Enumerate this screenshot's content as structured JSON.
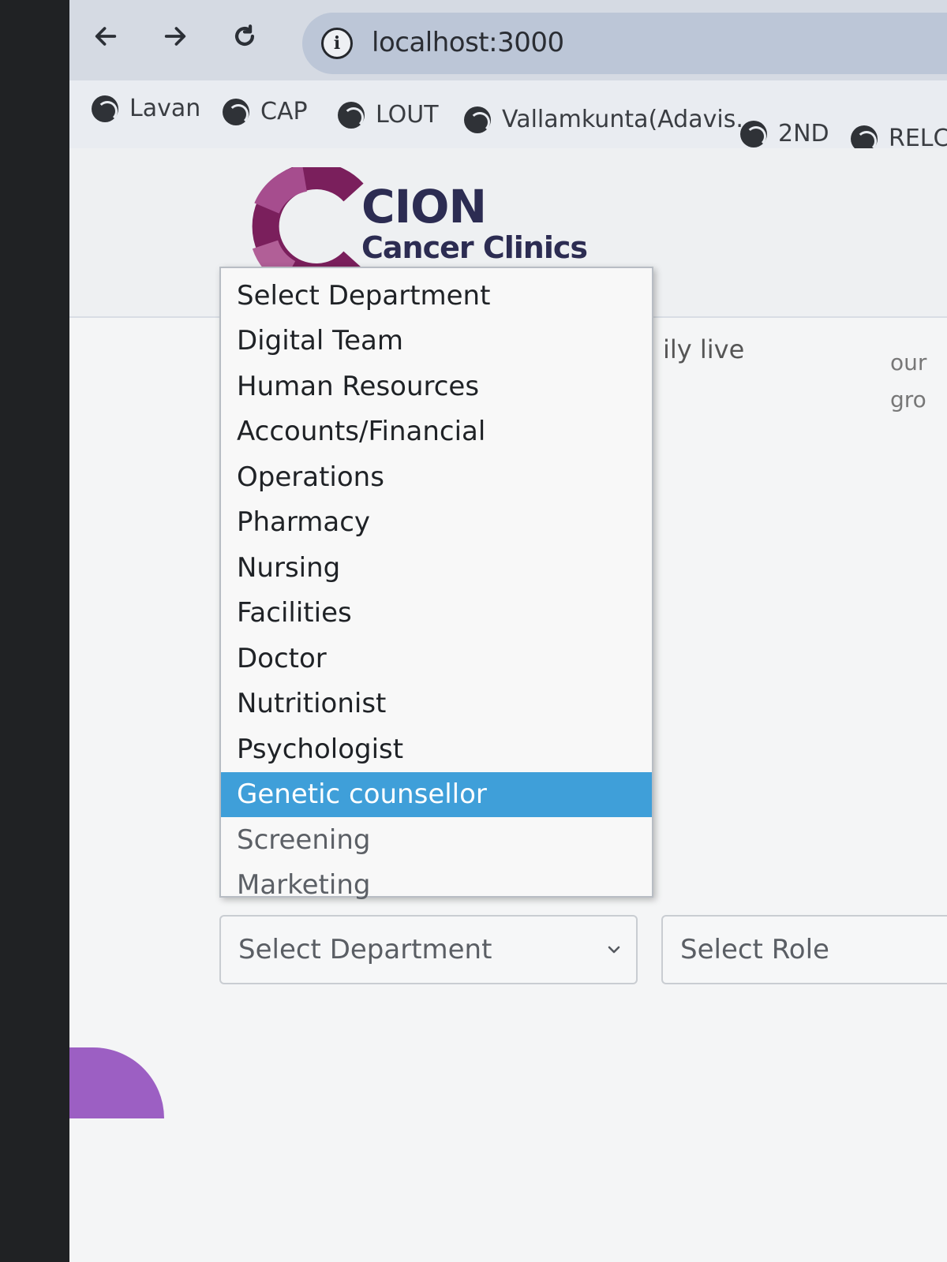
{
  "browser": {
    "url": "localhost:3000",
    "bookmarks": [
      "Lavan",
      "CAP",
      "LOUT",
      "Vallamkunta(Adavis...",
      "2ND",
      "RELC"
    ]
  },
  "logo": {
    "title": "CION",
    "subtitle": "Cancer Clinics",
    "colors": {
      "ring_dark": "#7a1f5c",
      "ring_light": "#a64d8e",
      "text": "#2c2c52"
    }
  },
  "background_text": {
    "line1": "ily live",
    "right1": "our",
    "right2": "gro"
  },
  "department_dropdown": {
    "options": [
      "Select Department",
      "Digital Team",
      "Human Resources",
      "Accounts/Financial",
      "Operations",
      "Pharmacy",
      "Nursing",
      "Facilities",
      "Doctor",
      "Nutritionist",
      "Psychologist",
      "Genetic counsellor",
      "Screening",
      "Marketing"
    ],
    "highlighted": "Genetic counsellor",
    "highlight_color": "#3f9fd9"
  },
  "selects": {
    "department_value": "Select Department",
    "role_value": "Select Role"
  }
}
